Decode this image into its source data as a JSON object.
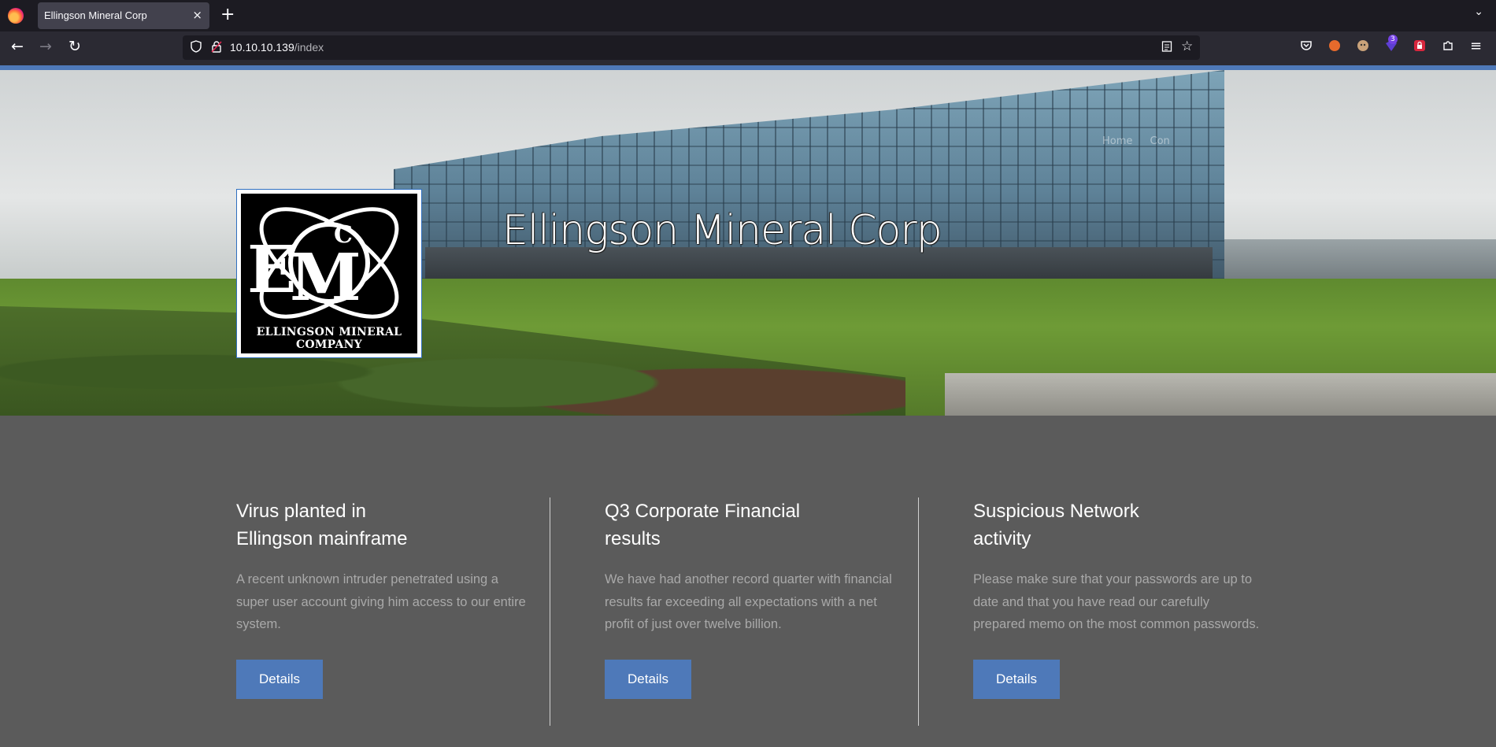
{
  "browser": {
    "tab_title": "Ellingson Mineral Corp",
    "tab_close": "×",
    "new_tab": "+",
    "tab_list": "⌄",
    "url_host": "10.10.10.139",
    "url_path": "/index",
    "extension_badge": "3"
  },
  "hero": {
    "title": "Ellingson Mineral Corp",
    "nav_items": [
      "Home",
      "Con"
    ],
    "logo_caption": "ELLINGSON MINERAL COMPANY",
    "logo_letters": {
      "e": "E",
      "m": "M",
      "c": "C"
    }
  },
  "articles": [
    {
      "title": "Virus planted in Ellingson mainframe",
      "body": "A recent unknown intruder penetrated using a super user account giving him access to our entire system.",
      "button": "Details"
    },
    {
      "title": "Q3 Corporate Financial results",
      "body": "We have had another record quarter with financial results far exceeding all expectations with a net profit of just over twelve billion.",
      "button": "Details"
    },
    {
      "title": "Suspicious Network activity",
      "body": "Please make sure that your passwords are up to date and that you have read our carefully prepared memo on the most common passwords.",
      "button": "Details"
    }
  ],
  "colors": {
    "accent": "#4e79b9",
    "page_bg": "#5b5b5b",
    "tab_bar": "#1c1b22",
    "toolbar": "#2b2a33"
  }
}
